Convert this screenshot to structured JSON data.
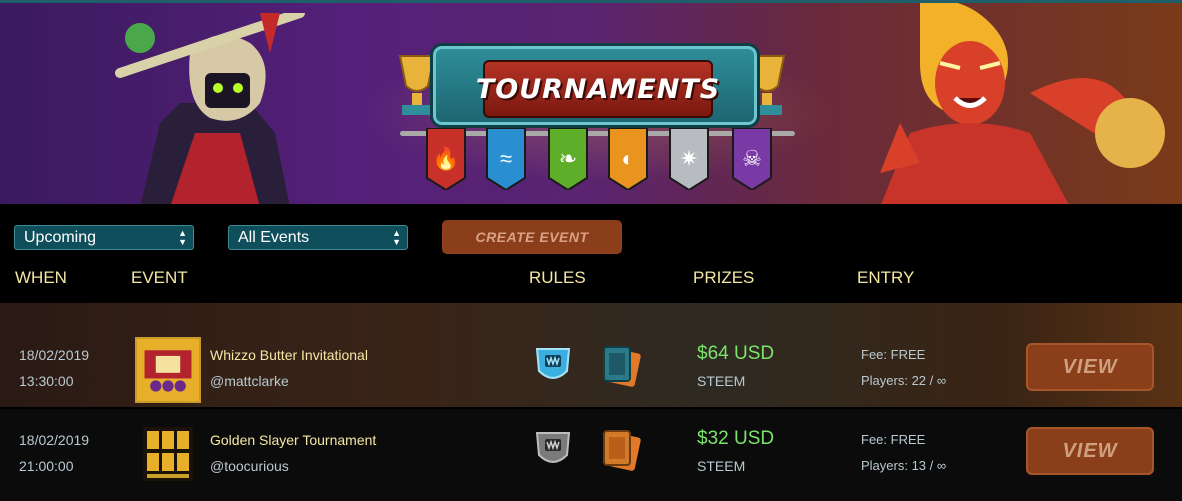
{
  "banner": {
    "title": "TOURNAMENTS",
    "flags": [
      {
        "icon": "fire-icon",
        "glyph": "🔥",
        "color": "#c8302a"
      },
      {
        "icon": "water-icon",
        "glyph": "≈",
        "color": "#2a8fd0"
      },
      {
        "icon": "earth-icon",
        "glyph": "❧",
        "color": "#5fae2a"
      },
      {
        "icon": "life-icon",
        "glyph": "◐",
        "color": "#e9941e"
      },
      {
        "icon": "dragon-icon",
        "glyph": "✷",
        "color": "#b8bcc0"
      },
      {
        "icon": "death-icon",
        "glyph": "☠",
        "color": "#7a3aa6"
      }
    ]
  },
  "filters": {
    "status_value": "Upcoming",
    "events_value": "All Events",
    "create_label": "CREATE EVENT"
  },
  "columns": {
    "when": "WHEN",
    "event": "EVENT",
    "rules": "RULES",
    "prizes": "PRIZES",
    "entry": "ENTRY"
  },
  "rows": [
    {
      "date": "18/02/2019",
      "time": "13:30:00",
      "name": "Whizzo Butter Invitational",
      "user": "@mattclarke",
      "prize": "$64 USD",
      "currency": "STEEM",
      "fee": "Fee: FREE",
      "players": "Players: 22 / ∞",
      "view_label": "VIEW",
      "rule_shield_color": "#3bb0e0",
      "rule_cards_color": "#2a7a8a"
    },
    {
      "date": "18/02/2019",
      "time": "21:00:00",
      "name": "Golden Slayer Tournament",
      "user": "@toocurious",
      "prize": "$32 USD",
      "currency": "STEEM",
      "fee": "Fee: FREE",
      "players": "Players: 13 / ∞",
      "view_label": "VIEW",
      "rule_shield_color": "#7a7a7a",
      "rule_cards_color": "#d07a2a"
    }
  ]
}
